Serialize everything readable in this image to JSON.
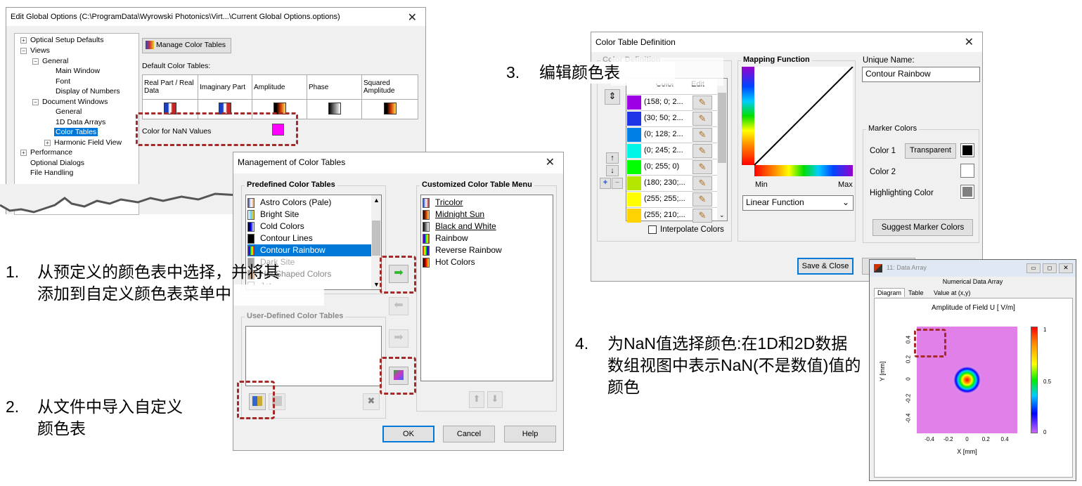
{
  "global_options": {
    "title": "Edit Global Options (C:\\ProgramData\\Wyrowski Photonics\\Virt...\\Current Global Options.options)",
    "tree": {
      "optical_setup_defaults": "Optical Setup Defaults",
      "views": "Views",
      "general": "General",
      "main_window": "Main Window",
      "font": "Font",
      "display_of_numbers": "Display of Numbers",
      "document_windows": "Document Windows",
      "dw_general": "General",
      "data_arrays_1d": "1D Data Arrays",
      "color_tables": "Color Tables",
      "harmonic_field_view": "Harmonic Field View",
      "performance": "Performance",
      "optional_dialogs": "Optional Dialogs",
      "file_handling": "File Handling"
    },
    "manage_button": "Manage Color Tables",
    "default_color_tables_label": "Default Color Tables:",
    "columns": [
      "Real Part / Real Data",
      "Imaginary Part",
      "Amplitude",
      "Phase",
      "Squared Amplitude"
    ],
    "nan_label": "Color for NaN Values",
    "nan_color": "#ff00ff"
  },
  "management": {
    "title": "Management of Color Tables",
    "predefined_title": "Predefined Color Tables",
    "predefined": [
      "Astro Colors (Pale)",
      "Bright Site",
      "Cold Colors",
      "Contour Lines",
      "Contour Rainbow",
      "Dark Site",
      "Hot Shaped Colors"
    ],
    "predefined_tail": "Ho",
    "predefined_partial": "Jet",
    "user_defined_title": "User-Defined Color Tables",
    "customized_title": "Customized Color Table Menu",
    "customized": [
      "Tricolor",
      "Midnight Sun",
      "Black and White",
      "Rainbow",
      "Reverse Rainbow",
      "Hot Colors"
    ],
    "ok": "OK",
    "cancel": "Cancel",
    "help": "Help"
  },
  "definition": {
    "title": "Color Table Definition",
    "color_definition_title": "Color Definition",
    "col_color": "Color",
    "col_edit": "Edit",
    "rows": [
      "(158; 0; 2...",
      "(30; 50; 2...",
      "(0; 128; 2...",
      "(0; 245; 2...",
      "(0; 255; 0)",
      "(180; 230;...",
      "(255; 255;...",
      "(255; 210;..."
    ],
    "row_colors": [
      "#9e00e6",
      "#1e32e6",
      "#0080e6",
      "#00f5e6",
      "#00ff00",
      "#b4e600",
      "#ffff00",
      "#ffd200"
    ],
    "interpolate": "Interpolate Colors",
    "mapping_title": "Mapping Function",
    "min": "Min",
    "max": "Max",
    "mapping_select": "Linear Function",
    "unique_name_label": "Unique Name:",
    "unique_name_value": "Contour Rainbow",
    "marker_colors_title": "Marker Colors",
    "color1": "Color 1",
    "transparent": "Transparent",
    "color2": "Color 2",
    "highlighting": "Highlighting Color",
    "suggest": "Suggest Marker Colors",
    "save_close": "Save & Close"
  },
  "data_array": {
    "title": "11: Data Array",
    "subtitle": "Numerical Data Array",
    "tabs": [
      "Diagram",
      "Table",
      "Value at (x,y)"
    ],
    "plot_title": "Amplitude of Field U  [ V/m]",
    "ylabel": "Y [mm]",
    "xlabel": "X [mm]",
    "xticks": [
      "-0.4",
      "-0.2",
      "0",
      "0.2",
      "0.4"
    ],
    "yticks": [
      "0.4",
      "0.2",
      "0",
      "-0.2",
      "-0.4"
    ],
    "cbar_ticks": [
      "1",
      "0.5",
      "0"
    ]
  },
  "annotations": {
    "a1_num": "1.",
    "a1_text": "从预定义的颜色表中选择，并将其添加到自定义颜色表菜单中",
    "a2_num": "2.",
    "a2_text": "从文件中导入自定义颜色表",
    "a3_num": "3.",
    "a3_text": "编辑颜色表",
    "a4_num": "4.",
    "a4_text": "为NaN值选择颜色:在1D和2D数据数组视图中表示NaN(不是数值)值的颜色"
  }
}
